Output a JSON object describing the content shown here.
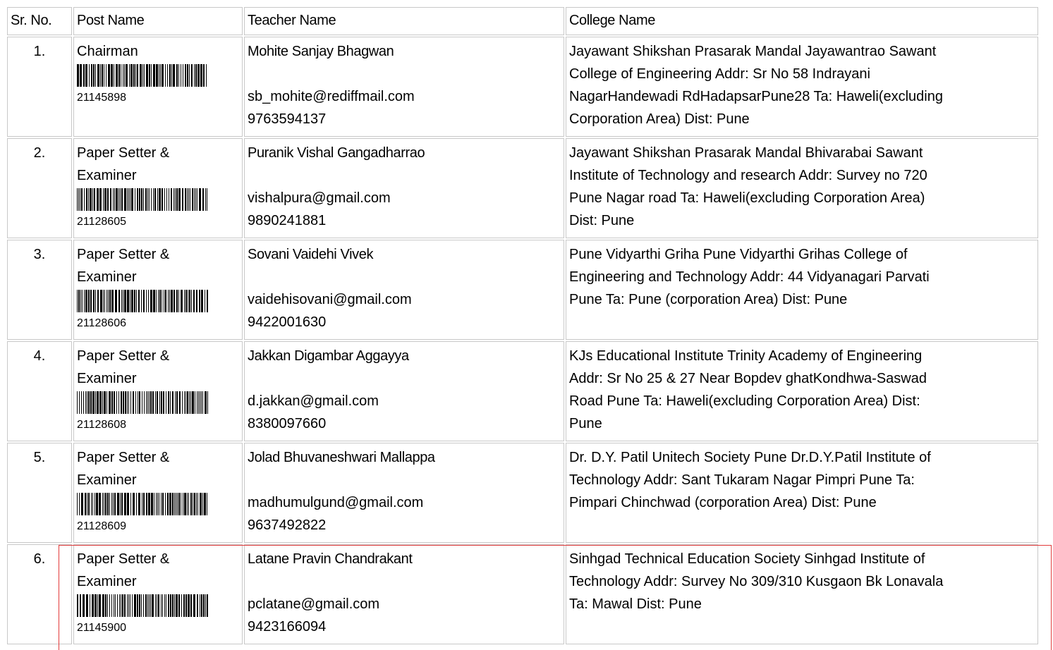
{
  "headers": {
    "sr": "Sr. No.",
    "post": "Post Name",
    "teacher": "Teacher Name",
    "college": "College Name"
  },
  "rows": [
    {
      "sr": "1.",
      "post_lines": [
        "Chairman"
      ],
      "code": "21145898",
      "teacher": "Mohite Sanjay Bhagwan",
      "email": "sb_mohite@rediffmail.com",
      "phone": "9763594137",
      "college_lines": [
        "Jayawant Shikshan Prasarak Mandal Jayawantrao Sawant",
        "College of Engineering Addr: Sr No 58 Indrayani",
        "NagarHandewadi RdHadapsarPune28 Ta: Haweli(excluding",
        "Corporation Area) Dist: Pune"
      ]
    },
    {
      "sr": "2.",
      "post_lines": [
        "Paper Setter &",
        "Examiner"
      ],
      "code": "21128605",
      "teacher": "Puranik Vishal Gangadharrao",
      "email": "vishalpura@gmail.com",
      "phone": "9890241881",
      "college_lines": [
        "Jayawant Shikshan Prasarak Mandal Bhivarabai Sawant",
        "Institute of Technology and research Addr: Survey no 720",
        "Pune Nagar road Ta: Haweli(excluding Corporation Area)",
        "Dist: Pune"
      ]
    },
    {
      "sr": "3.",
      "post_lines": [
        "Paper Setter &",
        "Examiner"
      ],
      "code": "21128606",
      "teacher": "Sovani Vaidehi Vivek",
      "email": "vaidehisovani@gmail.com",
      "phone": "9422001630",
      "college_lines": [
        "Pune Vidyarthi Griha Pune Vidyarthi Grihas College of",
        "Engineering and Technology Addr: 44 Vidyanagari Parvati",
        "Pune Ta: Pune (corporation Area) Dist: Pune"
      ]
    },
    {
      "sr": "4.",
      "post_lines": [
        "Paper Setter &",
        "Examiner"
      ],
      "code": "21128608",
      "teacher": "Jakkan Digambar Aggayya",
      "email": "d.jakkan@gmail.com",
      "phone": "8380097660",
      "college_lines": [
        "KJs Educational Institute Trinity Academy of Engineering",
        "Addr: Sr No 25 & 27 Near Bopdev ghatKondhwa-Saswad",
        "Road Pune Ta: Haweli(excluding Corporation Area) Dist:",
        "Pune"
      ]
    },
    {
      "sr": "5.",
      "post_lines": [
        "Paper Setter &",
        "Examiner"
      ],
      "code": "21128609",
      "teacher": "Jolad Bhuvaneshwari Mallappa",
      "email": "madhumulgund@gmail.com",
      "phone": "9637492822",
      "college_lines": [
        "Dr. D.Y. Patil Unitech Society Pune Dr.D.Y.Patil Institute of",
        "Technology Addr: Sant Tukaram Nagar Pimpri Pune Ta:",
        "Pimpari Chinchwad (corporation Area) Dist: Pune"
      ]
    },
    {
      "sr": "6.",
      "post_lines": [
        "Paper Setter &",
        "Examiner"
      ],
      "code": "21145900",
      "teacher": "Latane Pravin Chandrakant",
      "email": "pclatane@gmail.com",
      "phone": "9423166094",
      "college_lines": [
        "Sinhgad Technical Education Society Sinhgad Institute of",
        "Technology Addr: Survey No 309/310 Kusgaon Bk Lonavala",
        "Ta: Mawal Dist: Pune"
      ]
    }
  ],
  "highlight_color": "#e23b3b"
}
